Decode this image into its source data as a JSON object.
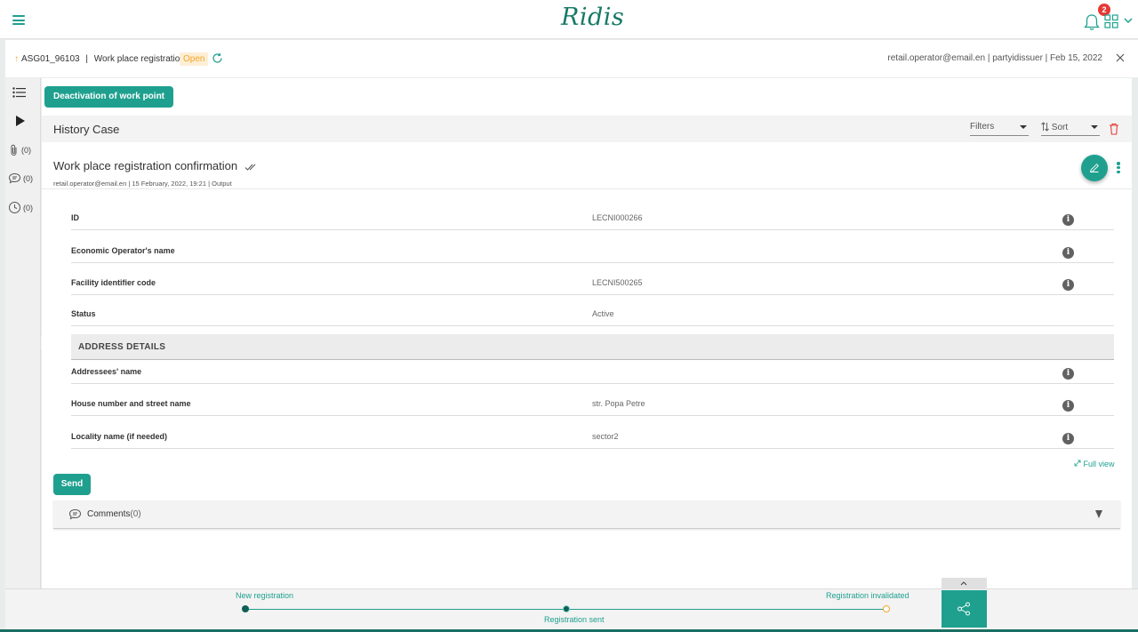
{
  "topbar": {
    "logo": "Ridis",
    "notification_count": "2"
  },
  "case_header": {
    "case_id": "ASG01_96103",
    "separator": "|",
    "case_type": "Work place registration",
    "status": "Open",
    "meta": "retail.operator@email.en | partyidissuer | Feb 15, 2022"
  },
  "left_rail": {
    "attachments_count": "(0)",
    "comments_count": "(0)",
    "history_count": "(0)"
  },
  "actions": {
    "deactivate_label": "Deactivation of work point"
  },
  "history": {
    "title": "History Case",
    "filters_label": "Filters",
    "sort_label": "Sort"
  },
  "entry": {
    "title": "Work place registration confirmation",
    "meta": "retail.operator@email.en | 15 February, 2022, 19:21 | Output"
  },
  "fields": [
    {
      "label": "ID",
      "value": "LECNI000266"
    },
    {
      "label": "Economic Operator's name",
      "value": ""
    },
    {
      "label": "Facility identifier code",
      "value": "LECNI500265"
    },
    {
      "label": "Status",
      "value": "Active"
    },
    {
      "label": "Addressees' name",
      "value": ""
    },
    {
      "label": "House number and street name",
      "value": "str. Popa Petre"
    },
    {
      "label": "Locality name (if needed)",
      "value": "sector2"
    }
  ],
  "section": {
    "address_title": "ADDRESS DETAILS"
  },
  "full_view_label": "Full view",
  "send_label": "Send",
  "comments": {
    "label": "Comments",
    "count": "(0)"
  },
  "workflow": {
    "steps": [
      {
        "label": "New registration",
        "state": "done"
      },
      {
        "label": "Registration sent",
        "state": "current"
      },
      {
        "label": "Registration invalidated",
        "state": "pending"
      }
    ]
  },
  "colors": {
    "accent": "#1fa08f",
    "status_open": "#f5a623",
    "badge": "#e53935"
  }
}
